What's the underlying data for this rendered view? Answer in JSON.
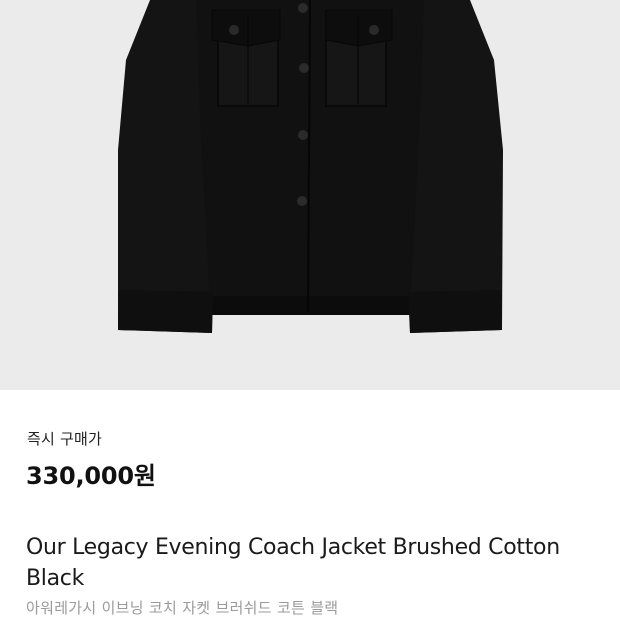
{
  "product": {
    "image_icon": "black-coach-jacket-photo",
    "price_label": "즉시 구매가",
    "price": "330,000원",
    "title": "Our Legacy Evening Coach Jacket Brushed Cotton Black",
    "subtitle": "아워레가시 이브닝 코치 자켓 브러쉬드 코튼 블랙"
  },
  "colors": {
    "image_background": "#ebebeb",
    "jacket": "#121212",
    "price_text": "#111111",
    "subtitle_text": "#9a9a9a"
  }
}
